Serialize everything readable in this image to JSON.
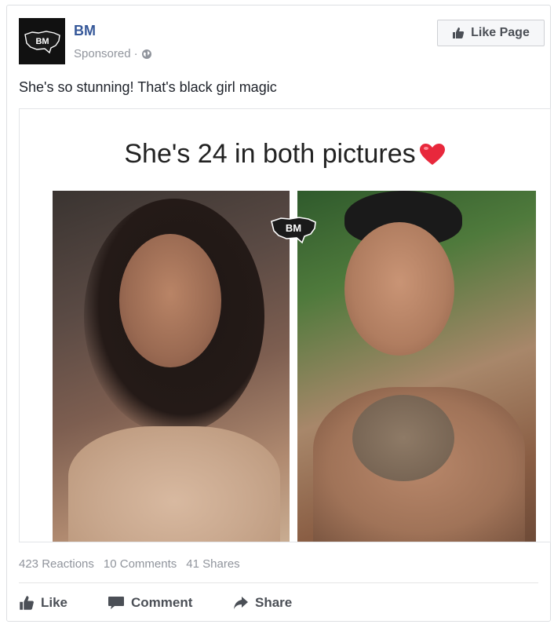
{
  "post": {
    "page_name": "BM",
    "sponsored_label": "Sponsored",
    "meta_separator": "·",
    "privacy_icon": "globe-icon",
    "like_page_label": "Like Page",
    "avatar_text": "BM",
    "text": "She's so stunning! That's black girl magic"
  },
  "media": {
    "caption": "She's 24 in both pictures",
    "caption_emoji": "heart-icon",
    "watermark_text": "BM"
  },
  "stats": {
    "reactions": "423 Reactions",
    "comments": "10 Comments",
    "shares": "41 Shares"
  },
  "actions": {
    "like": "Like",
    "comment": "Comment",
    "share": "Share"
  },
  "colors": {
    "link_blue": "#365899",
    "meta_gray": "#90949c",
    "action_gray": "#4b4f56",
    "heart_red": "#e8283c"
  }
}
